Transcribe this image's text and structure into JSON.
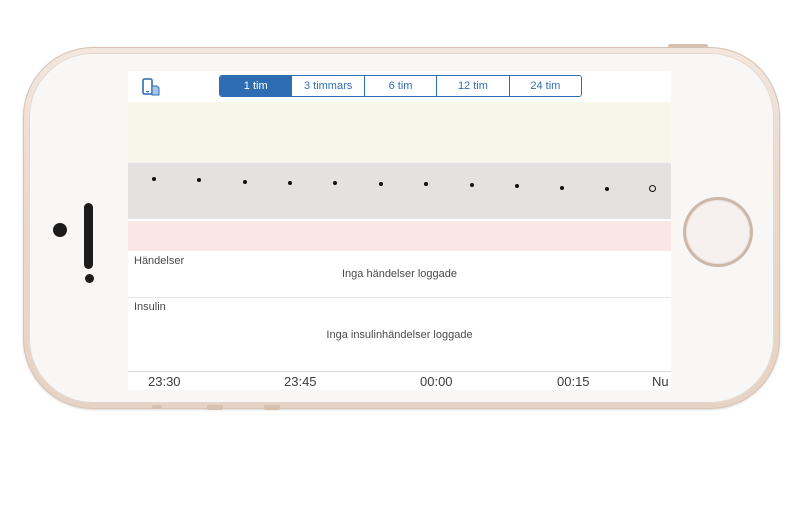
{
  "toolbar": {
    "device_icon": "phone-device-icon",
    "ranges": [
      {
        "label": "1 tim",
        "active": true
      },
      {
        "label": "3 timmars",
        "active": false
      },
      {
        "label": "6 tim",
        "active": false
      },
      {
        "label": "12 tim",
        "active": false
      },
      {
        "label": "24 tim",
        "active": false
      }
    ]
  },
  "events": {
    "title": "Händelser",
    "empty": "Inga händelser loggade"
  },
  "insulin": {
    "title": "Insulin",
    "empty": "Inga insulinhändelser loggade"
  },
  "time_axis": [
    "23:30",
    "23:45",
    "00:00",
    "00:15",
    "Nu"
  ],
  "colors": {
    "accent": "#2f6db3",
    "high_zone": "#f8f5e9",
    "target_zone": "#e4e2e1",
    "low_zone": "#fbe6e6",
    "phone_gold": "#ead8cb"
  }
}
